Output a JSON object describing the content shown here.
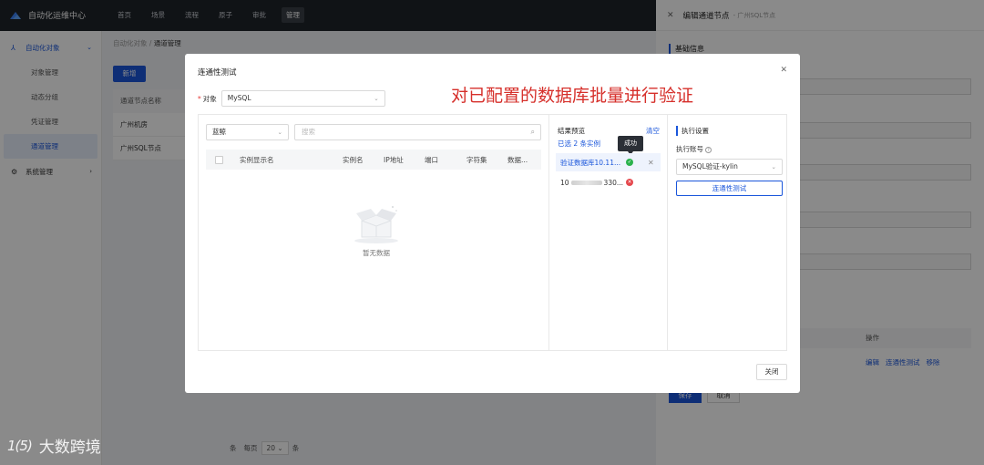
{
  "app": {
    "title": "自动化运维中心",
    "nav": [
      "首页",
      "场景",
      "流程",
      "原子",
      "审批",
      "管理"
    ]
  },
  "sidebar": {
    "group_automation": "自动化对象",
    "items": [
      "对象管理",
      "动态分组",
      "凭证管理",
      "通道管理"
    ],
    "group_system": "系统管理"
  },
  "main": {
    "breadcrumb_parent": "自动化对象",
    "breadcrumb_sep": "/",
    "breadcrumb_current": "通道管理",
    "new_button": "新增",
    "table_header": "通道节点名称",
    "rows": [
      "广州机房",
      "广州SQL节点"
    ],
    "pager_suffix": "条",
    "pager_per_page": "每页",
    "pager_size": "20",
    "pager_unit": "条"
  },
  "drawer": {
    "title": "编辑通道节点",
    "subtitle": "- 广州SQL节点",
    "section": "基础信息",
    "op_header": "操作",
    "links": [
      "编辑",
      "连通性测试",
      "移除"
    ],
    "ok_button": "保存",
    "cancel_button": "取消"
  },
  "modal": {
    "title": "连通性测试",
    "annotation": "对已配置的数据库批量进行验证",
    "object_label": "对象",
    "object_value": "MySQL",
    "filter_value": "蓝鲸",
    "search_placeholder": "搜索",
    "columns": [
      "实例显示名",
      "实例名",
      "IP地址",
      "端口",
      "字符集",
      "数据..."
    ],
    "empty_text": "暂无数据",
    "preview_title": "结果预览",
    "clear_label": "清空",
    "selected_count": "已选 2 条实例",
    "tooltip": "成功",
    "results": [
      {
        "name": "验证数据库10.11...",
        "status": "success"
      },
      {
        "prefix": "10",
        "suffix": "330...",
        "status": "error"
      }
    ],
    "exec_title": "执行设置",
    "account_label": "执行账号",
    "account_value": "MySQL验证-kylin",
    "test_button": "连通性测试",
    "close_button": "关闭"
  },
  "watermark": {
    "logo": "1(5)",
    "text": "大数跨境"
  },
  "colors": {
    "primary": "#1a56db",
    "success": "#2bb24c",
    "error": "#e5484d",
    "annotation": "#d6302b"
  }
}
